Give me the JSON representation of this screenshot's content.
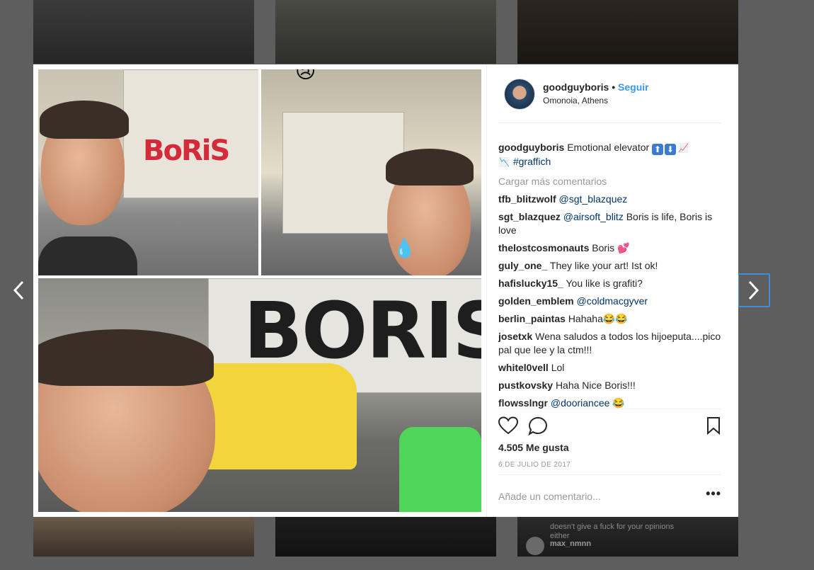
{
  "post": {
    "username": "goodguyboris",
    "separator": "•",
    "follow_label": "Seguir",
    "location": "Omonoia, Athens"
  },
  "photo": {
    "graffiti_top": "BoRiS",
    "graffiti_big": "BORIS"
  },
  "caption": {
    "username": "goodguyboris",
    "text": "Emotional elevator",
    "emojis": [
      "⬆️",
      "⬇️",
      "📈",
      "📉"
    ],
    "hashtag": "#graffich"
  },
  "load_more_label": "Cargar más comentarios",
  "comments": [
    {
      "user": "tfb_blitzwolf",
      "mention": "@sgt_blazquez",
      "text": ""
    },
    {
      "user": "sgt_blazquez",
      "mention": "@airsoft_blitz",
      "text": "Boris is life, Boris is love"
    },
    {
      "user": "thelostcosmonauts",
      "mention": "",
      "text": "Boris 💕"
    },
    {
      "user": "guly_one_",
      "mention": "",
      "text": "They like your art! Ist ok!"
    },
    {
      "user": "hafislucky15_",
      "mention": "",
      "text": "You like is grafiti?"
    },
    {
      "user": "golden_emblem",
      "mention": "@coldmacgyver",
      "text": ""
    },
    {
      "user": "berlin_paintas",
      "mention": "",
      "text": "Hahaha😂😂"
    },
    {
      "user": "josetxk",
      "mention": "",
      "text": "Wena saludos a todos los hijoeputa....pico pal que lee y la ctm!!!"
    },
    {
      "user": "whitel0vell",
      "mention": "",
      "text": "Lol"
    },
    {
      "user": "pustkovsky",
      "mention": "",
      "text": "Haha Nice Boris!!!"
    },
    {
      "user": "flowsslngr",
      "mention": "@dooriancee",
      "text": "😂"
    }
  ],
  "likes_text": "4.505 Me gusta",
  "date_text": "6 DE JULIO DE 2017",
  "add_comment_placeholder": "Añade un comentario...",
  "more_options_label": "•••",
  "background": {
    "tile_text": "doesn't give a fuck for your opinions either",
    "tile_user": "max_nmnn"
  }
}
